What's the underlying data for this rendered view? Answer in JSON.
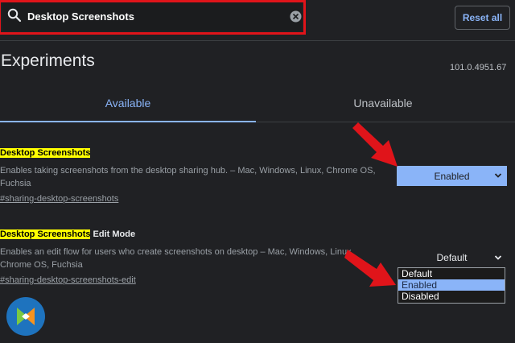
{
  "search": {
    "query": "Desktop Screenshots"
  },
  "header": {
    "reset_label": "Reset all"
  },
  "page": {
    "title": "Experiments",
    "version": "101.0.4951.67"
  },
  "tabs": [
    {
      "label": "Available",
      "active": true
    },
    {
      "label": "Unavailable",
      "active": false
    }
  ],
  "experiments": [
    {
      "title_highlight": "Desktop Screenshots",
      "title_rest": "",
      "description": "Enables taking screenshots from the desktop sharing hub. – Mac, Windows, Linux, Chrome OS, Fuchsia",
      "link": "#sharing-desktop-screenshots",
      "select_value": "Enabled"
    },
    {
      "title_highlight": "Desktop Screenshots",
      "title_rest": " Edit Mode",
      "description": "Enables an edit flow for users who create screenshots on desktop – Mac, Windows, Linux, Chrome OS, Fuchsia",
      "link": "#sharing-desktop-screenshots-edit",
      "select_value": "Default",
      "dropdown_options": [
        "Default",
        "Enabled",
        "Disabled"
      ],
      "dropdown_selected": "Enabled"
    }
  ],
  "colors": {
    "accent": "#8ab4f8",
    "highlight": "#ffff00",
    "annotation_arrow": "#e0141a",
    "search_outline": "#e0141a"
  }
}
